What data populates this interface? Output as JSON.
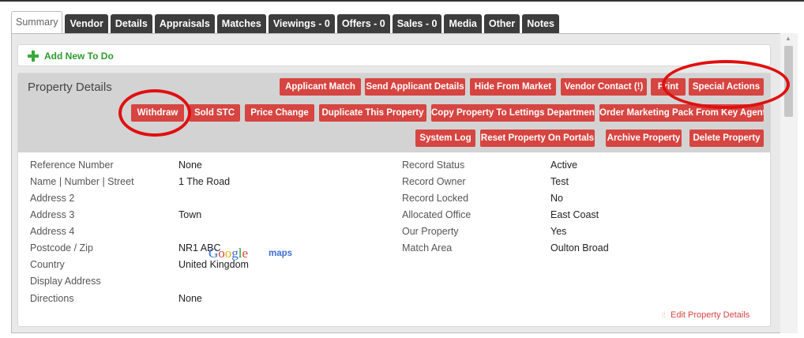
{
  "tabs": [
    {
      "label": "Summary",
      "active": true
    },
    {
      "label": "Vendor"
    },
    {
      "label": "Details"
    },
    {
      "label": "Appraisals"
    },
    {
      "label": "Matches"
    },
    {
      "label": "Viewings - 0"
    },
    {
      "label": "Offers - 0"
    },
    {
      "label": "Sales - 0"
    },
    {
      "label": "Media"
    },
    {
      "label": "Other"
    },
    {
      "label": "Notes"
    }
  ],
  "todo": {
    "label": "Add New To Do",
    "icon": "plus-icon"
  },
  "property": {
    "title": "Property Details",
    "buttons_row1": [
      "Applicant Match",
      "Send Applicant Details",
      "Hide From Market",
      "Vendor Contact (!)",
      "Print",
      "Special Actions"
    ],
    "buttons_row2": [
      "Withdraw",
      "Sold STC",
      "Price Change",
      "Duplicate This Property",
      "Copy Property To Lettings Department",
      "Order Marketing Pack From Key Agent"
    ],
    "buttons_row3": [
      "System Log",
      "Reset Property On Portals",
      "Archive Property",
      "Delete Property"
    ],
    "fields_left": [
      {
        "label": "Reference Number",
        "value": "None"
      },
      {
        "label": "Name | Number | Street",
        "value": "1 The Road"
      },
      {
        "label": "Address 2",
        "value": ""
      },
      {
        "label": "Address 3",
        "value": "Town"
      },
      {
        "label": "Address 4",
        "value": ""
      },
      {
        "label": "Postcode / Zip",
        "value": "NR1 ABC"
      },
      {
        "label": "Country",
        "value": "United Kingdom"
      },
      {
        "label": "Display Address",
        "value": ""
      },
      {
        "label": "Directions",
        "value": "None"
      }
    ],
    "fields_right": [
      {
        "label": "Record Status",
        "value": "Active"
      },
      {
        "label": "Record Owner",
        "value": "Test"
      },
      {
        "label": "Record Locked",
        "value": "No"
      },
      {
        "label": "Allocated Office",
        "value": "East Coast"
      },
      {
        "label": "Our Property",
        "value": "Yes"
      },
      {
        "label": "Match Area",
        "value": "Oulton Broad"
      }
    ],
    "maps_link": {
      "google": "Google",
      "maps": "maps"
    },
    "edit_link": "Edit Property Details"
  },
  "colors": {
    "accent": "#d64541",
    "tab_bg": "#3d3d3d",
    "highlight_circle": "#e01010",
    "todo_green": "#2e9b2e"
  }
}
